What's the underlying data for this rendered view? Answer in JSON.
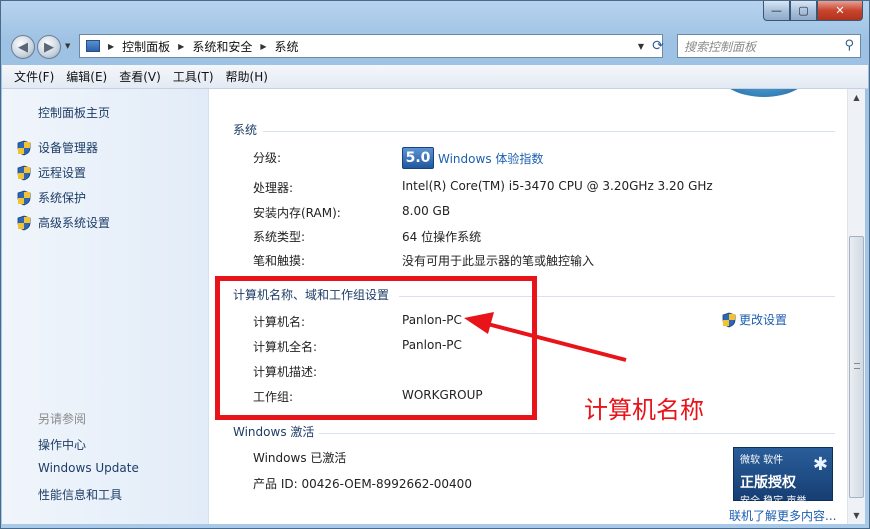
{
  "window": {
    "min_label": "—",
    "max_label": "▢",
    "close_label": "✕"
  },
  "nav": {
    "breadcrumbs": [
      "控制面板",
      "系统和安全",
      "系统"
    ],
    "search_placeholder": "搜索控制面板"
  },
  "menu": [
    "文件(F)",
    "编辑(E)",
    "查看(V)",
    "工具(T)",
    "帮助(H)"
  ],
  "sidebar": {
    "home": "控制面板主页",
    "items": [
      {
        "label": "设备管理器",
        "icon": "shield-icon"
      },
      {
        "label": "远程设置",
        "icon": "shield-icon"
      },
      {
        "label": "系统保护",
        "icon": "shield-icon"
      },
      {
        "label": "高级系统设置",
        "icon": "shield-icon"
      }
    ],
    "see_also": "另请参阅",
    "see_also_items": [
      "操作中心",
      "Windows Update",
      "性能信息和工具"
    ]
  },
  "system": {
    "title": "系统",
    "rating_label": "分级:",
    "rating_score": "5.0",
    "rating_link": "Windows 体验指数",
    "rows": [
      {
        "label": "处理器:",
        "value": "Intel(R) Core(TM) i5-3470 CPU @ 3.20GHz   3.20 GHz"
      },
      {
        "label": "安装内存(RAM):",
        "value": "8.00 GB"
      },
      {
        "label": "系统类型:",
        "value": "64 位操作系统"
      },
      {
        "label": "笔和触摸:",
        "value": "没有可用于此显示器的笔或触控输入"
      }
    ]
  },
  "computer": {
    "title": "计算机名称、域和工作组设置",
    "change_link": "更改设置",
    "rows": [
      {
        "label": "计算机名:",
        "value": "Panlon-PC"
      },
      {
        "label": "计算机全名:",
        "value": "Panlon-PC"
      },
      {
        "label": "计算机描述:",
        "value": ""
      },
      {
        "label": "工作组:",
        "value": "WORKGROUP"
      }
    ]
  },
  "activation": {
    "title": "Windows 激活",
    "status": "Windows 已激活",
    "product_id": "产品 ID: 00426-OEM-8992662-00400",
    "more_link": "联机了解更多内容...",
    "logo_top": "微软 软件",
    "logo_main": "正版授权",
    "logo_sub": "安全 稳定 声誉"
  },
  "annotation": {
    "text": "计算机名称",
    "color": "#e8141a"
  }
}
